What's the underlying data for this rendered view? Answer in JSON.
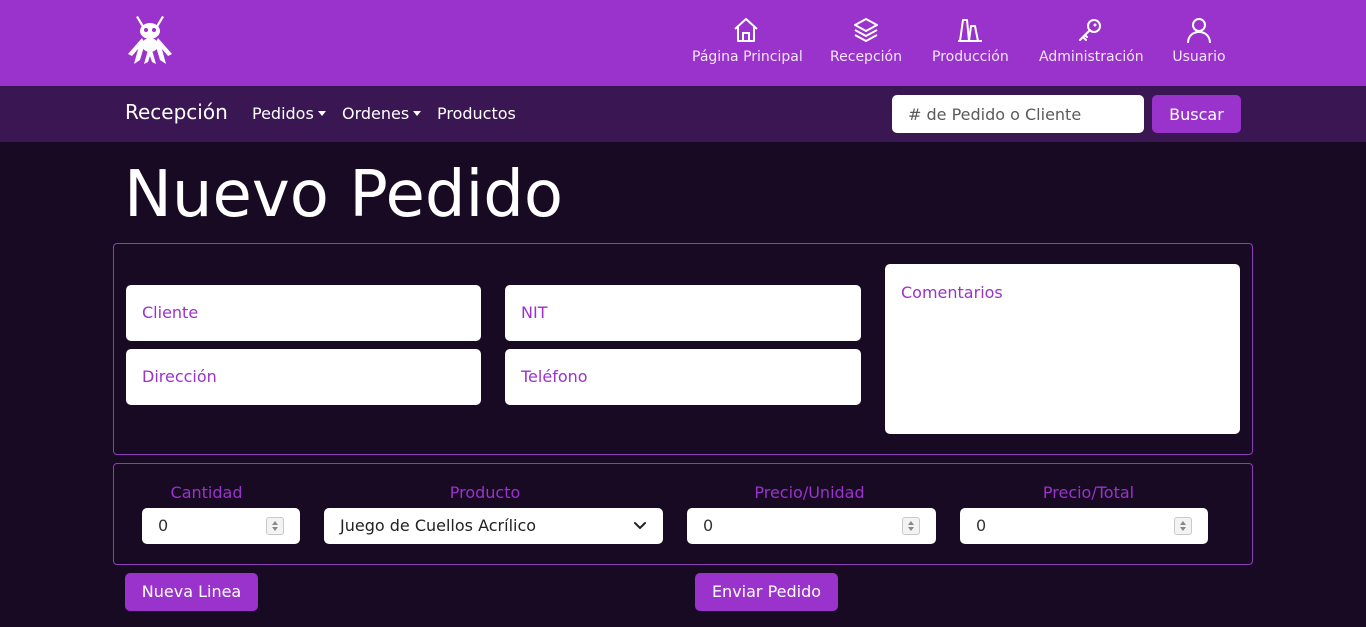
{
  "topnav": {
    "logo_icon": "ant-logo-icon",
    "items": [
      {
        "label": "Página Principal",
        "icon": "home-icon"
      },
      {
        "label": "Recepción",
        "icon": "layers-icon"
      },
      {
        "label": "Producción",
        "icon": "factory-icon"
      },
      {
        "label": "Administración",
        "icon": "key-icon"
      },
      {
        "label": "Usuario",
        "icon": "user-icon"
      }
    ]
  },
  "subnav": {
    "brand": "Recepción",
    "menus": [
      {
        "label": "Pedidos",
        "dropdown": true
      },
      {
        "label": "Ordenes",
        "dropdown": true
      },
      {
        "label": "Productos",
        "dropdown": false
      }
    ],
    "search": {
      "placeholder": "# de Pedido o Cliente",
      "value": ""
    },
    "search_button": "Buscar"
  },
  "page": {
    "title": "Nuevo Pedido"
  },
  "form": {
    "cliente": "Cliente",
    "nit": "NIT",
    "direccion": "Dirección",
    "telefono": "Teléfono",
    "comentarios": "Comentarios"
  },
  "line": {
    "cantidad_label": "Cantidad",
    "cantidad_value": "0",
    "producto_label": "Producto",
    "producto_value": "Juego de Cuellos Acrílico",
    "precio_unidad_label": "Precio/Unidad",
    "precio_unidad_value": "0",
    "precio_total_label": "Precio/Total",
    "precio_total_value": "0"
  },
  "actions": {
    "nueva_linea": "Nueva Linea",
    "enviar_pedido": "Enviar Pedido"
  },
  "colors": {
    "primary": "#9a32cc",
    "subbar": "#3a1653",
    "background": "#180a22"
  }
}
